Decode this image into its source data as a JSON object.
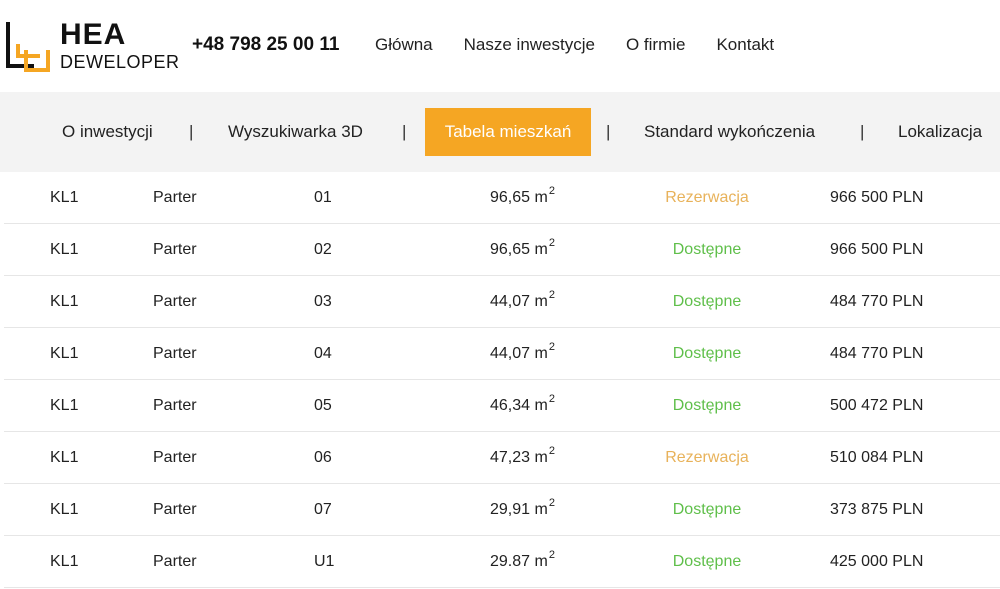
{
  "brand": {
    "name": "HEA",
    "subtitle": "DEWELOPER",
    "accent": "#f5a623"
  },
  "header": {
    "phone": "+48 798 25 00 11",
    "nav": [
      "Główna",
      "Nasze inwestycje",
      "O firmie",
      "Kontakt"
    ]
  },
  "subnav": {
    "items": [
      "O inwestycji",
      "Wyszukiwarka 3D",
      "Tabela mieszkań",
      "Standard wykończenia",
      "Lokalizacja"
    ],
    "separator": "|",
    "active": "Tabela mieszkań"
  },
  "table": {
    "area_unit": "m",
    "area_exp": "2",
    "rows": [
      {
        "building": "KL1",
        "floor": "Parter",
        "number": "01",
        "area": "96,65",
        "status": "Rezerwacja",
        "price": "966 500 PLN"
      },
      {
        "building": "KL1",
        "floor": "Parter",
        "number": "02",
        "area": "96,65",
        "status": "Dostępne",
        "price": "966 500 PLN"
      },
      {
        "building": "KL1",
        "floor": "Parter",
        "number": "03",
        "area": "44,07",
        "status": "Dostępne",
        "price": "484 770 PLN"
      },
      {
        "building": "KL1",
        "floor": "Parter",
        "number": "04",
        "area": "44,07",
        "status": "Dostępne",
        "price": "484 770 PLN"
      },
      {
        "building": "KL1",
        "floor": "Parter",
        "number": "05",
        "area": "46,34",
        "status": "Dostępne",
        "price": "500 472 PLN"
      },
      {
        "building": "KL1",
        "floor": "Parter",
        "number": "06",
        "area": "47,23",
        "status": "Rezerwacja",
        "price": "510 084 PLN"
      },
      {
        "building": "KL1",
        "floor": "Parter",
        "number": "07",
        "area": "29,91",
        "status": "Dostępne",
        "price": "373 875 PLN"
      },
      {
        "building": "KL1",
        "floor": "Parter",
        "number": "U1",
        "area": "29.87",
        "status": "Dostępne",
        "price": "425 000 PLN"
      }
    ]
  },
  "colors": {
    "available": "#5fbf4a",
    "reserved": "#e8b25a",
    "subnav_bg": "#f3f3f3"
  }
}
